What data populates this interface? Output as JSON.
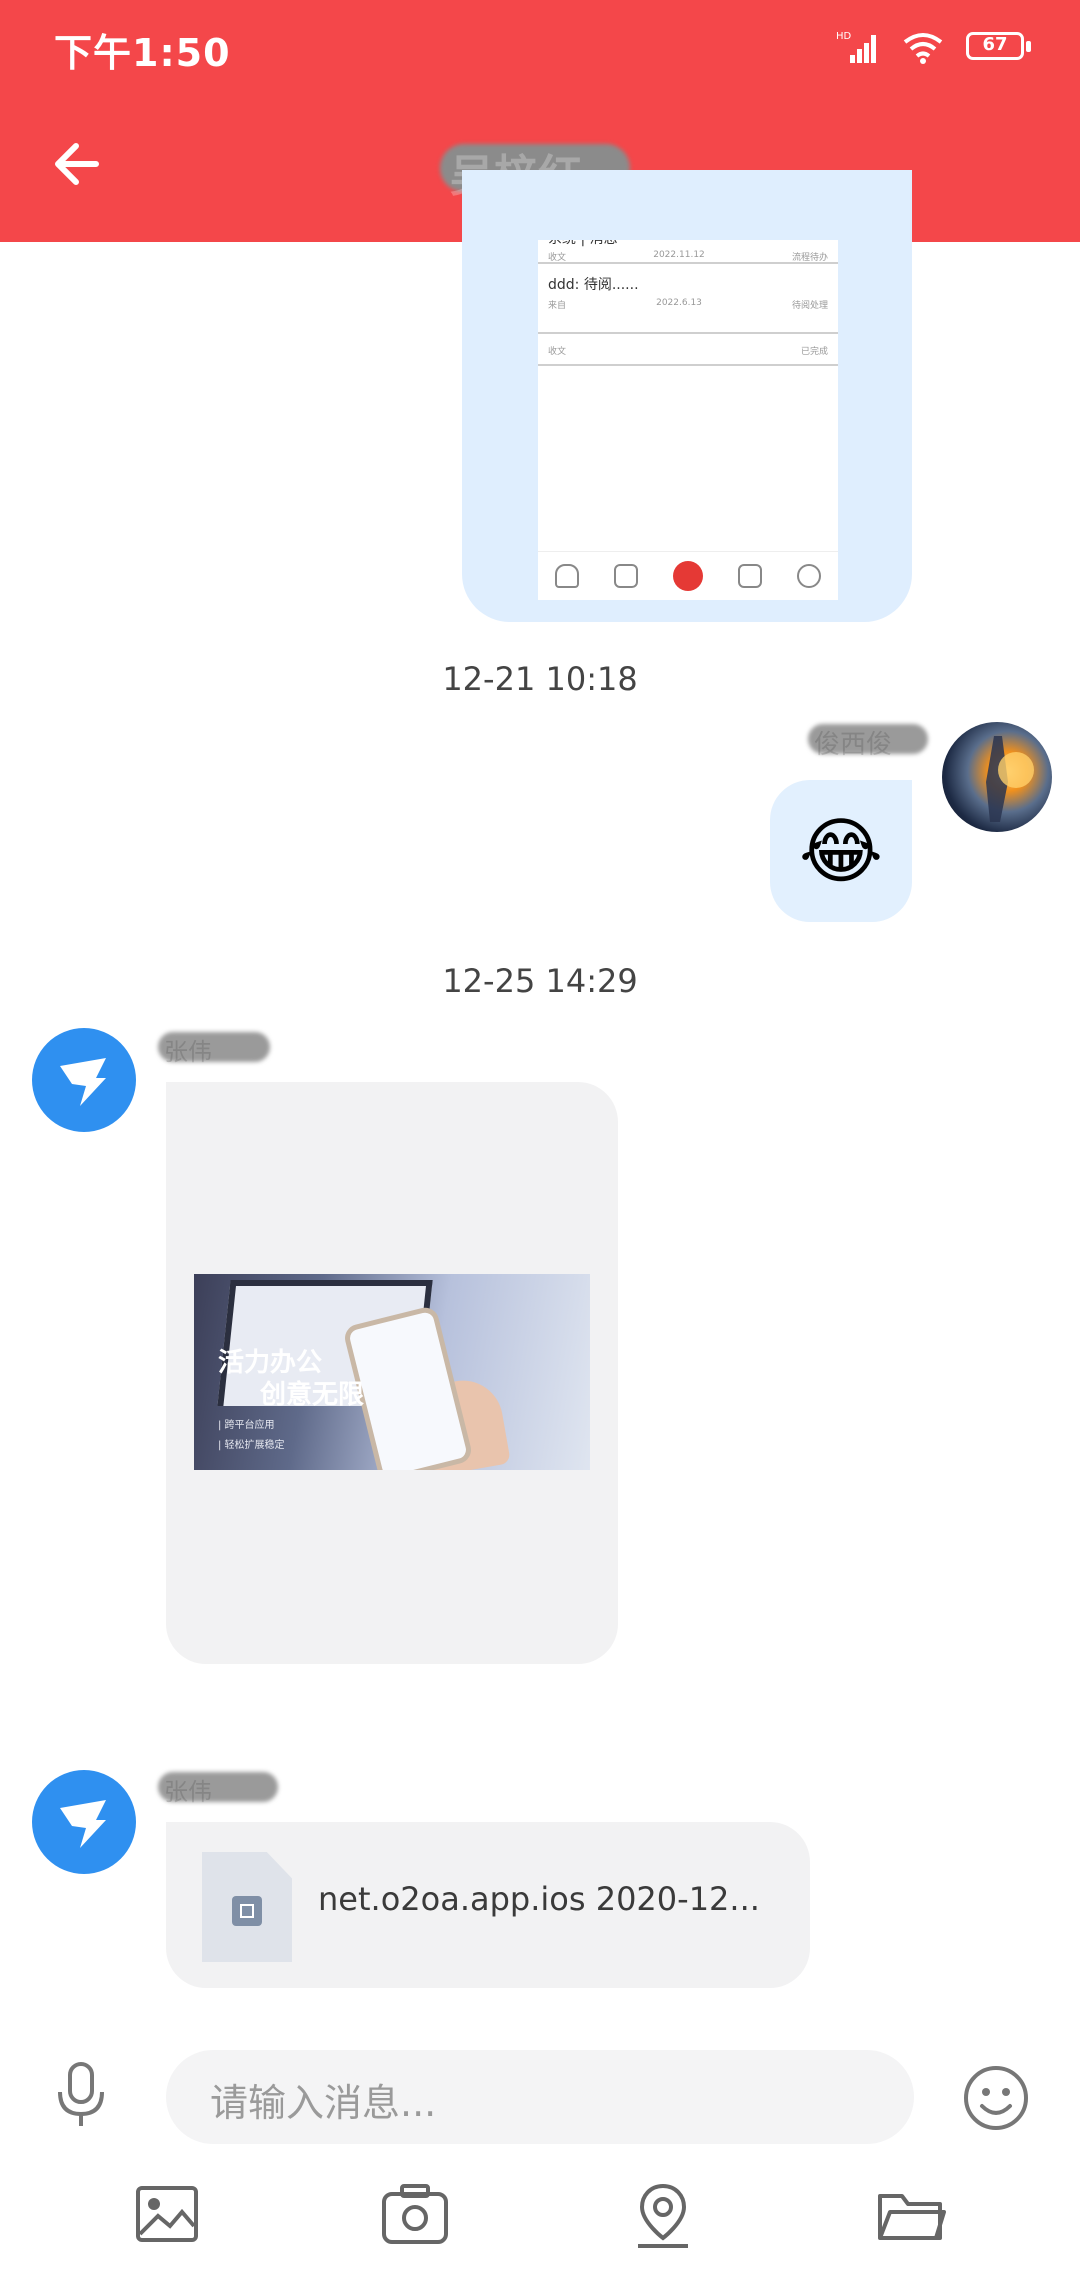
{
  "status_bar": {
    "time": "下午1:50",
    "network": "HD",
    "battery": "67"
  },
  "header": {
    "title": "吴梓红",
    "back_icon": "arrow-left-icon"
  },
  "messages": {
    "screenshot_preview": {
      "rows": [
        {
          "title": "系统 | 消息",
          "meta_left": "收文",
          "meta_mid": "2022.11.12",
          "meta_right": "流程待办"
        },
        {
          "title": "ddd: 待阅......",
          "meta_left": "来自",
          "meta_mid": "2022.6.13",
          "meta_right": "待阅处理"
        },
        {
          "title": "",
          "meta_left": "收文",
          "meta_right": "已完成"
        }
      ]
    },
    "timestamp_1": "12-21 10:18",
    "my_name": "俊西俊",
    "emoji": "😂",
    "timestamp_2": "12-25 14:29",
    "bot_name_1": "张伟",
    "promo": {
      "title1": "活力办公",
      "title2": "创意无限",
      "sub1": "| 跨平台应用",
      "sub2": "| 轻松扩展稳定"
    },
    "bot_name_2": "张伟",
    "file_name": "net.o2oa.app.ios 2020-12..."
  },
  "input": {
    "placeholder": "请输入消息..."
  },
  "toolbar": {
    "items": [
      "image-icon",
      "camera-icon",
      "location-icon",
      "folder-icon"
    ]
  },
  "colors": {
    "header": "#f4474a",
    "my_bubble": "#e2f0fe",
    "other_bubble": "#f2f2f3",
    "bot_avatar": "#2f90f0"
  }
}
